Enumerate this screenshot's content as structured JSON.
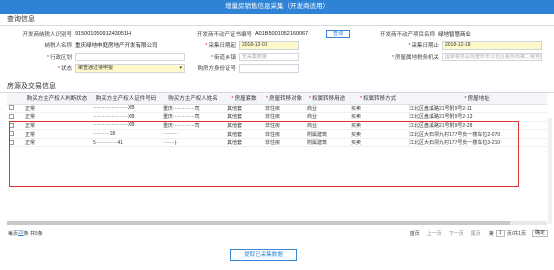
{
  "header": {
    "title": "增量房销售信息采集（开发商适用）"
  },
  "sections": {
    "query": "查询信息",
    "property": "房源及交易信息"
  },
  "form": {
    "dev_taxpayer_id_label": "开发商纳税人识别号",
    "dev_taxpayer_id_value": "91500105091243051H",
    "presale_license_label": "开发商不动产证书编号",
    "presale_license_value": "A01B5001052160067",
    "query_button": "查询",
    "project_name_label": "开发商不动产项目名称",
    "project_name_value": "绿地智慧商业",
    "taxpayer_name_label": "纳税人名称",
    "taxpayer_name_value": "重庆绿地申庭房地产开发有限公司",
    "start_date_label": "采集日期起",
    "start_date_value": "2018-12-01",
    "end_date_label": "采集日期止",
    "end_date_value": "2018-12-18",
    "district_label": "行政区划",
    "district_value": "",
    "street_label": "街道乡镇",
    "street_value": "",
    "street_placeholder": "无采集数量",
    "housing_agency_label": "房屋属地税务机关",
    "housing_agency_value": "国家税务总局重庆市江北区税务局第二税务所",
    "status_label": "状态",
    "status_value": "审查通过待申报",
    "buyer_id_label": "购房方身份证号",
    "buyer_id_value": ""
  },
  "table": {
    "columns": [
      "",
      "购买方主产权人判断状态",
      "购买方主产权人证件号码",
      "购买方主产权人姓名",
      "房屋套数",
      "房屋转移对象",
      "权属转移用途",
      "权属转移方式",
      "房屋地址"
    ],
    "rows": [
      {
        "status": "正常",
        "id": "·····················XB",
        "name": "重庆·············司",
        "count": "其他套",
        "object": "非住房",
        "usage": "商业",
        "method": "买卖",
        "address": "江北区盘溪路21号附9号2-11"
      },
      {
        "status": "正常",
        "id": "·····················XB",
        "name": "重庆·············司",
        "count": "其他套",
        "object": "非住房",
        "usage": "商业",
        "method": "买卖",
        "address": "江北区盘溪路21号附9号2-13"
      },
      {
        "status": "正常",
        "id": "·····················XB",
        "name": "重庆·············司",
        "count": "其他套",
        "object": "非住房",
        "usage": "商业",
        "method": "买卖",
        "address": "江北区盘溪路21号附9号2-28"
      },
      {
        "status": "正常",
        "id": "··········18",
        "name": "·········",
        "count": "其他套",
        "object": "非住房",
        "usage": "附属建筑",
        "method": "买卖",
        "address": "江北区大石坝九村177号负一楼车位2-070"
      },
      {
        "status": "正常",
        "id": "5·············41",
        "name": "·······|·",
        "count": "其他套",
        "object": "非住房",
        "usage": "附属建筑",
        "method": "买卖",
        "address": "江北区大石坝九村177号负一楼车位3-210"
      }
    ]
  },
  "pager": {
    "page_size_prefix": "每页",
    "page_size": "20",
    "page_size_suffix": "条",
    "total": "共5条",
    "first": "首页",
    "prev": "上一页",
    "next": "下一页",
    "last": "尾页",
    "page_prefix": "第",
    "page_current": "1",
    "page_suffix": "页/共1页",
    "go": "确定"
  },
  "footer": {
    "submit_button": "提取已采集数据"
  }
}
